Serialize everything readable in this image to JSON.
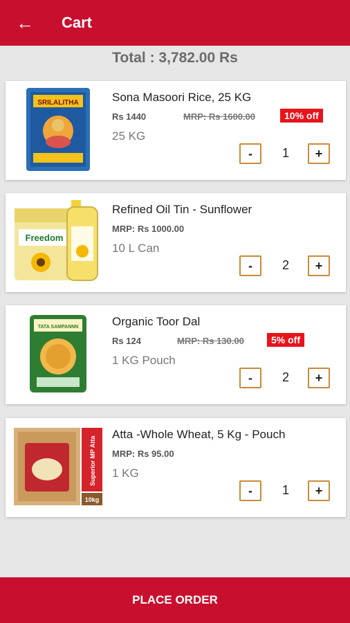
{
  "appbar": {
    "back_icon": "arrow-left-icon",
    "title": "Cart"
  },
  "summary": {
    "total": "Total : 3,782.00 Rs"
  },
  "colors": {
    "primary": "#c8102e",
    "discount_badge": "#e8141c",
    "qty_border": "#c98a3a"
  },
  "items": [
    {
      "name": "Sona Masoori Rice, 25 KG",
      "price": "Rs 1440",
      "mrp": "MRP: Rs 1600.00",
      "discount": "10% off",
      "unit": "25 KG",
      "quantity": "1",
      "minus_label": "-",
      "plus_label": "+",
      "image_icon": "rice-bag-icon",
      "image_text": "SRILALITHA"
    },
    {
      "name": "Refined Oil Tin - Sunflower",
      "mrp": "MRP: Rs 1000.00",
      "unit": "10 L Can",
      "quantity": "2",
      "minus_label": "-",
      "plus_label": "+",
      "image_icon": "oil-tin-icon",
      "image_text": "Freedom"
    },
    {
      "name": "Organic Toor Dal",
      "price": "Rs 124",
      "mrp": "MRP: Rs 130.00",
      "discount": "5% off",
      "unit": "1 KG Pouch",
      "quantity": "2",
      "minus_label": "-",
      "plus_label": "+",
      "image_icon": "dal-pouch-icon",
      "image_text": "TATA SAMPANNN"
    },
    {
      "name": "Atta -Whole Wheat, 5 Kg - Pouch",
      "mrp": "MRP: Rs 95.00",
      "unit": "1 KG",
      "quantity": "1",
      "minus_label": "-",
      "plus_label": "+",
      "image_icon": "atta-bag-icon",
      "image_text": "Superior MP Atta",
      "image_text_2": "10kg"
    }
  ],
  "footer": {
    "place_order_label": "PLACE ORDER"
  }
}
